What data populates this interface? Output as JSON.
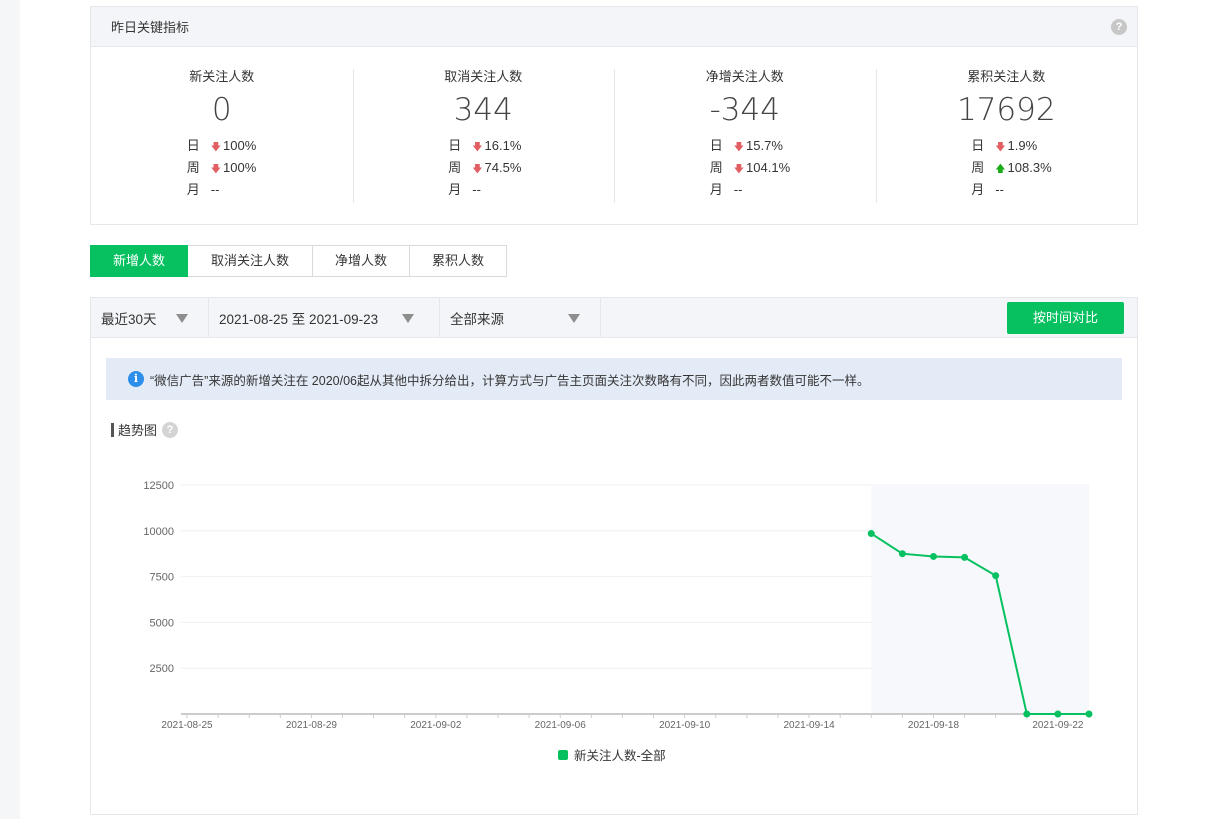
{
  "metrics": {
    "header": "昨日关键指标",
    "help": "?",
    "labels": {
      "day": "日",
      "week": "周",
      "month": "月"
    },
    "items": [
      {
        "title": "新关注人数",
        "value": "0",
        "day": {
          "dir": "down",
          "pct": "100%"
        },
        "week": {
          "dir": "down",
          "pct": "100%"
        },
        "month": "--"
      },
      {
        "title": "取消关注人数",
        "value": "344",
        "day": {
          "dir": "down",
          "pct": "16.1%"
        },
        "week": {
          "dir": "down",
          "pct": "74.5%"
        },
        "month": "--"
      },
      {
        "title": "净增关注人数",
        "value": "-344",
        "day": {
          "dir": "down",
          "pct": "15.7%"
        },
        "week": {
          "dir": "down",
          "pct": "104.1%"
        },
        "month": "--"
      },
      {
        "title": "累积关注人数",
        "value": "17692",
        "day": {
          "dir": "down",
          "pct": "1.9%"
        },
        "week": {
          "dir": "up",
          "pct": "108.3%"
        },
        "month": "--"
      }
    ]
  },
  "tabs": [
    {
      "label": "新增人数",
      "active": true
    },
    {
      "label": "取消关注人数",
      "active": false
    },
    {
      "label": "净增人数",
      "active": false
    },
    {
      "label": "累积人数",
      "active": false
    }
  ],
  "filters": {
    "range": "最近30天",
    "dates": "2021-08-25 至 2021-09-23",
    "source": "全部来源",
    "compare": "按时间对比"
  },
  "notice": "“微信广告”来源的新增关注在 2020/06起从其他中拆分给出，计算方式与广告主页面关注次数略有不同，因此两者数值可能不一样。",
  "trend": {
    "title": "趋势图",
    "help": "?"
  },
  "colors": {
    "accent": "#07c160",
    "down": "#e15f63",
    "up": "#1aad19",
    "info": "#2d8fea"
  },
  "chart_data": {
    "type": "line",
    "x": [
      "2021-08-25",
      "2021-08-26",
      "2021-08-27",
      "2021-08-28",
      "2021-08-29",
      "2021-08-30",
      "2021-08-31",
      "2021-09-01",
      "2021-09-02",
      "2021-09-03",
      "2021-09-04",
      "2021-09-05",
      "2021-09-06",
      "2021-09-07",
      "2021-09-08",
      "2021-09-09",
      "2021-09-10",
      "2021-09-11",
      "2021-09-12",
      "2021-09-13",
      "2021-09-14",
      "2021-09-15",
      "2021-09-16",
      "2021-09-17",
      "2021-09-18",
      "2021-09-19",
      "2021-09-20",
      "2021-09-21",
      "2021-09-22",
      "2021-09-23"
    ],
    "x_ticks": [
      "2021-08-25",
      "2021-08-29",
      "2021-09-02",
      "2021-09-06",
      "2021-09-10",
      "2021-09-14",
      "2021-09-18",
      "2021-09-22"
    ],
    "y_ticks": [
      2500,
      5000,
      7500,
      10000,
      12500
    ],
    "ylim": [
      0,
      12500
    ],
    "series": [
      {
        "name": "新关注人数-全部",
        "points": [
          {
            "x": "2021-09-16",
            "y": 9850
          },
          {
            "x": "2021-09-17",
            "y": 8750
          },
          {
            "x": "2021-09-18",
            "y": 8600
          },
          {
            "x": "2021-09-19",
            "y": 8550
          },
          {
            "x": "2021-09-20",
            "y": 7550
          },
          {
            "x": "2021-09-21",
            "y": 0
          },
          {
            "x": "2021-09-22",
            "y": 0
          },
          {
            "x": "2021-09-23",
            "y": 0
          }
        ]
      }
    ],
    "grid": true,
    "legend": "bottom-center"
  }
}
